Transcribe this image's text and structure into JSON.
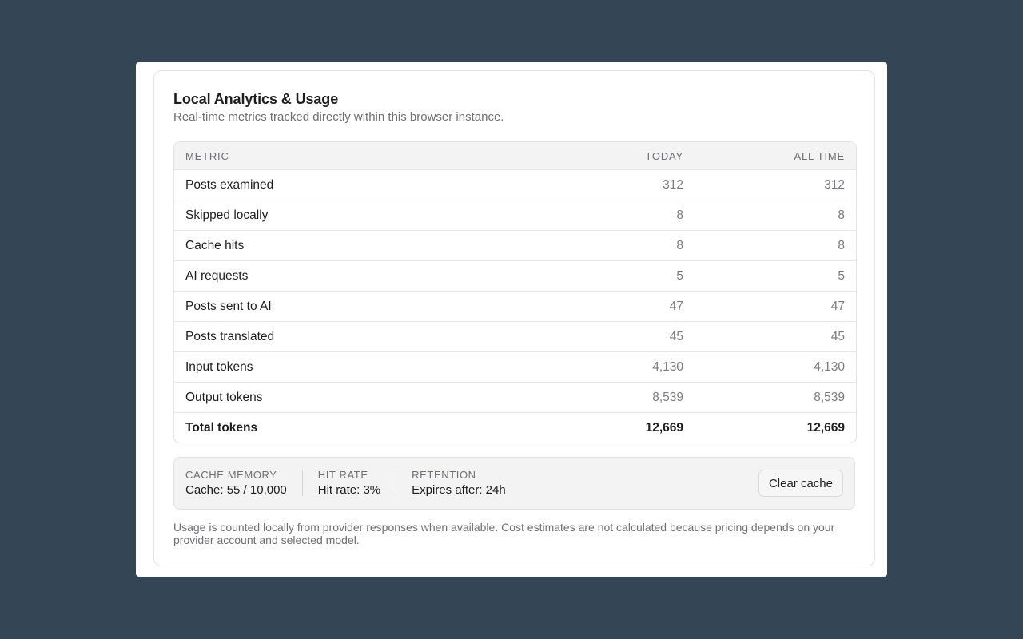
{
  "header": {
    "title": "Local Analytics & Usage",
    "subtitle": "Real-time metrics tracked directly within this browser instance."
  },
  "table": {
    "columns": [
      "Metric",
      "Today",
      "All time"
    ],
    "rows": [
      {
        "metric": "Posts examined",
        "today": "312",
        "all_time": "312"
      },
      {
        "metric": "Skipped locally",
        "today": "8",
        "all_time": "8"
      },
      {
        "metric": "Cache hits",
        "today": "8",
        "all_time": "8"
      },
      {
        "metric": "AI requests",
        "today": "5",
        "all_time": "5"
      },
      {
        "metric": "Posts sent to AI",
        "today": "47",
        "all_time": "47"
      },
      {
        "metric": "Posts translated",
        "today": "45",
        "all_time": "45"
      },
      {
        "metric": "Input tokens",
        "today": "4,130",
        "all_time": "4,130"
      },
      {
        "metric": "Output tokens",
        "today": "8,539",
        "all_time": "8,539"
      },
      {
        "metric": "Total tokens",
        "today": "12,669",
        "all_time": "12,669"
      }
    ]
  },
  "cache": {
    "memory_label": "Cache memory",
    "memory_value": "Cache: 55 / 10,000",
    "hit_rate_label": "Hit rate",
    "hit_rate_value": "Hit rate: 3%",
    "retention_label": "Retention",
    "retention_value": "Expires after: 24h",
    "clear_button": "Clear cache"
  },
  "footnote": "Usage is counted locally from provider responses when available. Cost estimates are not calculated because pricing depends on your provider account and selected model.",
  "colors": {
    "background": "#344556",
    "card": "#ffffff",
    "header_row": "#f3f3f4",
    "muted_text": "#6e6e73"
  }
}
